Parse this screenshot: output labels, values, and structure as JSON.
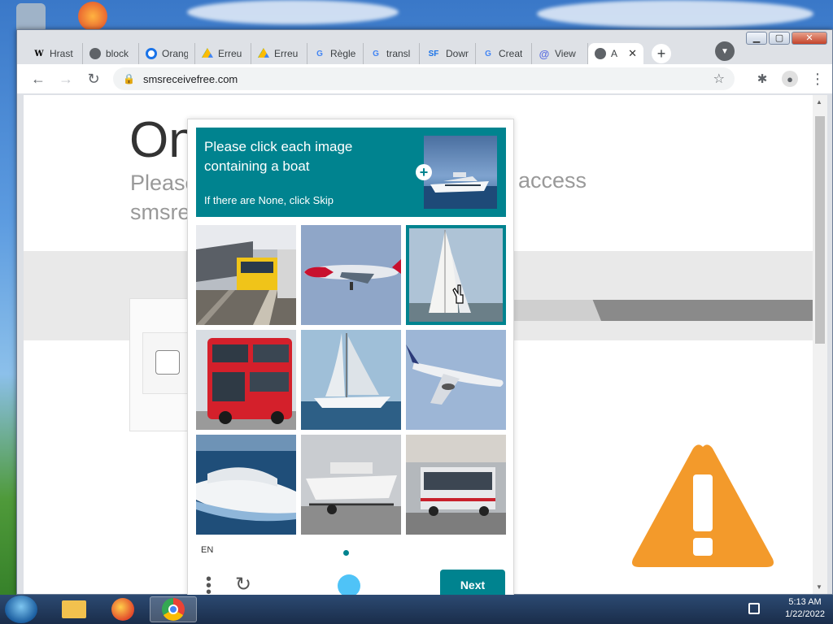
{
  "window": {
    "controls": {
      "minimize": "▁",
      "maximize": "▢",
      "close": "✕"
    }
  },
  "tabs": [
    {
      "label": "Hrast",
      "icon": "wikipedia-icon"
    },
    {
      "label": "block",
      "icon": "globe-icon"
    },
    {
      "label": "Orang",
      "icon": "orange-icon"
    },
    {
      "label": "Erreu",
      "icon": "google-drive-icon"
    },
    {
      "label": "Erreu",
      "icon": "google-drive-icon"
    },
    {
      "label": "Règle",
      "icon": "google-icon"
    },
    {
      "label": "transl",
      "icon": "google-icon"
    },
    {
      "label": "Down",
      "icon": "sourceforge-icon"
    },
    {
      "label": "Creat",
      "icon": "google-icon"
    },
    {
      "label": "View",
      "icon": "at-sign-icon"
    },
    {
      "label": "A",
      "icon": "globe-icon",
      "active": true
    }
  ],
  "toolbar": {
    "url": "smsreceivefree.com"
  },
  "page": {
    "title": "On",
    "subtitle_left_1": "Please",
    "subtitle_left_2": "smsre",
    "subtitle_right": "access"
  },
  "captcha": {
    "prompt": "Please click each image containing a boat",
    "skip_hint": "If there are None, click Skip",
    "language": "EN",
    "next_label": "Next",
    "images": [
      {
        "subject": "train at station",
        "selected": false
      },
      {
        "subject": "airplane",
        "selected": false
      },
      {
        "subject": "sailboat",
        "selected": true
      },
      {
        "subject": "red double-decker bus",
        "selected": false
      },
      {
        "subject": "sailing yacht",
        "selected": false
      },
      {
        "subject": "airplane",
        "selected": false
      },
      {
        "subject": "cruise yacht",
        "selected": false
      },
      {
        "subject": "motorboat on trailer",
        "selected": false
      },
      {
        "subject": "city bus",
        "selected": false
      }
    ]
  },
  "taskbar": {
    "time": "5:13 AM",
    "date": "1/22/2022"
  }
}
